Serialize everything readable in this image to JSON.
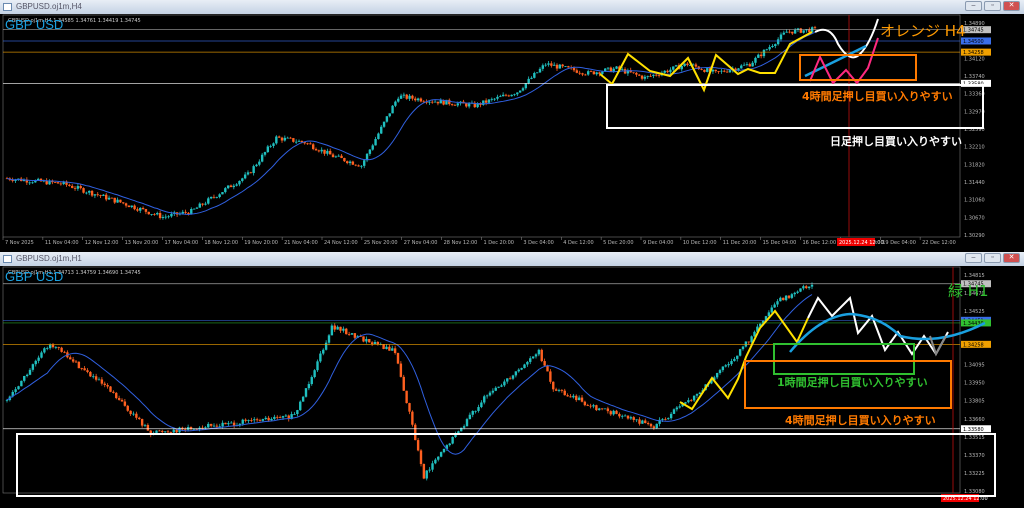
{
  "windows": [
    {
      "title": "GBPUSD.oj1m,H4",
      "ohlc": "GBPUSD.oj1m,H4 1.34585 1.34761 1.34419 1.34745",
      "symbol": "GBP USD",
      "tf_label": "オレンジ H4",
      "annotations": [
        "4時間足押し目買い入りやすい",
        "日足押し目買い入りやすい"
      ],
      "price_labels": [
        "1.34890",
        "1.34120",
        "1.33740",
        "1.33360",
        "1.32970",
        "1.32590",
        "1.32210",
        "1.31820",
        "1.31440",
        "1.31060",
        "1.30670",
        "1.30290"
      ],
      "markers": [
        {
          "text": "1.34745",
          "color": "#c0c0c0"
        },
        {
          "text": "1.34500",
          "color": "#3a6ee8"
        },
        {
          "text": "1.34258",
          "color": "#f0a000"
        },
        {
          "text": "1.33580",
          "color": "#ffffff"
        }
      ],
      "time_labels": [
        "7 Nov 2025",
        "11 Nov 04:00",
        "12 Nov 12:00",
        "13 Nov 20:00",
        "17 Nov 04:00",
        "18 Nov 12:00",
        "19 Nov 20:00",
        "21 Nov 04:00",
        "24 Nov 12:00",
        "25 Nov 20:00",
        "27 Nov 04:00",
        "28 Nov 12:00",
        "1 Dec 20:00",
        "3 Dec 04:00",
        "4 Dec 12:00",
        "5 Dec 20:00",
        "9 Dec 04:00",
        "10 Dec 12:00",
        "11 Dec 20:00",
        "15 Dec 04:00",
        "16 Dec 12:00",
        "17 Dec 20:00",
        "19 Dec 04:00",
        "22 Dec 12:00"
      ],
      "cursor_time": "2025.12.24 12:00"
    },
    {
      "title": "GBPUSD.oj1m,H1",
      "ohlc": "GBPUSD.oj1m,H1 1.34713 1.34759 1.34690 1.34745",
      "symbol": "GBP USD",
      "tf_label": "緑 H1",
      "annotations": [
        "1時間足押し目買い入りやすい",
        "4時間足押し目買い入りやすい"
      ],
      "price_labels": [
        "1.34815",
        "1.34670",
        "1.34525",
        "1.34095",
        "1.33950",
        "1.33805",
        "1.33660",
        "1.33515",
        "1.33370",
        "1.33225",
        "1.33080"
      ],
      "markers": [
        {
          "text": "1.34745",
          "color": "#c0c0c0"
        },
        {
          "text": "1.34451",
          "color": "#3a6ee8"
        },
        {
          "text": "1.34430",
          "color": "#30c030"
        },
        {
          "text": "1.34258",
          "color": "#f0a000"
        },
        {
          "text": "1.33580",
          "color": "#ffffff"
        }
      ],
      "cursor_time": "2025.12.24 12:00"
    }
  ],
  "chart_data": [
    {
      "type": "candlestick",
      "title": "GBPUSD.oj1m,H4",
      "ylim": [
        1.3029,
        1.3489
      ],
      "close_path": [
        [
          0,
          1.3152
        ],
        [
          20,
          1.314
        ],
        [
          40,
          1.31
        ],
        [
          55,
          1.3068
        ],
        [
          65,
          1.308
        ],
        [
          75,
          1.312
        ],
        [
          85,
          1.316
        ],
        [
          95,
          1.324
        ],
        [
          105,
          1.323
        ],
        [
          115,
          1.32
        ],
        [
          125,
          1.318
        ],
        [
          138,
          1.333
        ],
        [
          150,
          1.332
        ],
        [
          165,
          1.331
        ],
        [
          180,
          1.334
        ],
        [
          190,
          1.34
        ],
        [
          205,
          1.338
        ],
        [
          215,
          1.339
        ],
        [
          225,
          1.337
        ],
        [
          240,
          1.34
        ],
        [
          250,
          1.338
        ],
        [
          262,
          1.34
        ],
        [
          275,
          1.347
        ],
        [
          285,
          1.3475
        ]
      ],
      "ma_color": "#3060e0",
      "up_color": "#20c0c0",
      "down_color": "#ff6020"
    },
    {
      "type": "candlestick",
      "title": "GBPUSD.oj1m,H1",
      "ylim": [
        1.3308,
        1.34815
      ],
      "close_path": [
        [
          0,
          1.3381
        ],
        [
          15,
          1.3427
        ],
        [
          35,
          1.339
        ],
        [
          50,
          1.3355
        ],
        [
          70,
          1.336
        ],
        [
          100,
          1.3368
        ],
        [
          113,
          1.344
        ],
        [
          135,
          1.342
        ],
        [
          145,
          1.332
        ],
        [
          165,
          1.338
        ],
        [
          185,
          1.342
        ],
        [
          190,
          1.339
        ],
        [
          205,
          1.3375
        ],
        [
          225,
          1.336
        ],
        [
          240,
          1.3385
        ],
        [
          255,
          1.342
        ],
        [
          268,
          1.346
        ],
        [
          280,
          1.3475
        ]
      ],
      "ma_color": "#3060e0",
      "up_color": "#20c0c0",
      "down_color": "#ff6020"
    }
  ]
}
